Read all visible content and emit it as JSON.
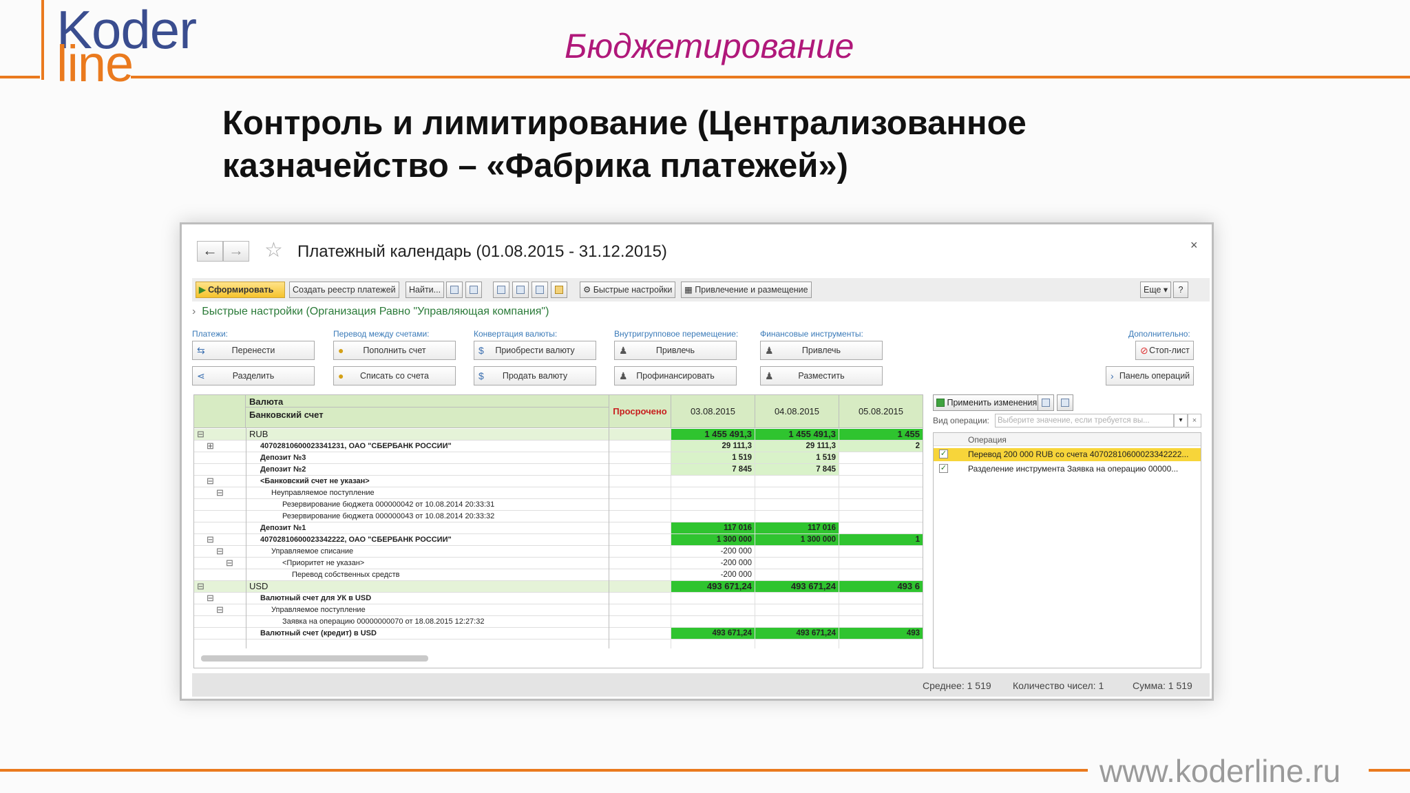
{
  "slide": {
    "logo_top": "Koder",
    "logo_bottom": "line",
    "title": "Бюджетирование",
    "heading_line1": "Контроль и лимитирование (Централизованное",
    "heading_line2": "казначейство – «Фабрика платежей»)",
    "url": "www.koderline.ru"
  },
  "window": {
    "title": "Платежный календарь (01.08.2015 - 31.12.2015)",
    "close": "×",
    "toolbar": {
      "generate": "Сформировать",
      "create_registry": "Создать реестр платежей",
      "find": "Найти...",
      "quick_settings": "Быстрые настройки",
      "attract_place": "Привлечение и размещение",
      "more": "Еще",
      "help": "?"
    },
    "quick_settings_line": "Быстрые настройки (Организация Равно \"Управляющая компания\")",
    "groups": {
      "payments": {
        "label": "Платежи:",
        "btn1": "Перенести",
        "btn2": "Разделить"
      },
      "transfer": {
        "label": "Перевод между счетами:",
        "btn1": "Пополнить счет",
        "btn2": "Списать со счета"
      },
      "conversion": {
        "label": "Конвертация валюты:",
        "btn1": "Приобрести валюту",
        "btn2": "Продать валюту"
      },
      "intragroup": {
        "label": "Внутригрупповое перемещение:",
        "btn1": "Привлечь",
        "btn2": "Профинансировать"
      },
      "financial": {
        "label": "Финансовые инструменты:",
        "btn1": "Привлечь",
        "btn2": "Разместить"
      },
      "additional": {
        "label": "Дополнительно:",
        "btn1": "Стоп-лист",
        "btn2": "Панель операций"
      }
    },
    "grid": {
      "header": {
        "col1a": "Валюта",
        "col1b": "Банковский счет",
        "overdue": "Просрочено",
        "d1": "03.08.2015",
        "d2": "04.08.2015",
        "d3": "05.08.2015"
      },
      "rows": [
        {
          "label": "RUB",
          "v1": "1 455 491,3",
          "v2": "1 455 491,3",
          "v3": "1 455"
        },
        {
          "label": "40702810600023341231, ОАО \"СБЕРБАНК РОССИИ\"",
          "v1": "29 111,3",
          "v2": "29 111,3",
          "v3": "2"
        },
        {
          "label": "Депозит №3",
          "v1": "1 519",
          "v2": "1 519",
          "v3": ""
        },
        {
          "label": "Депозит №2",
          "v1": "7 845",
          "v2": "7 845",
          "v3": ""
        },
        {
          "label": "<Банковский счет не указан>",
          "v1": "",
          "v2": "",
          "v3": ""
        },
        {
          "label": "Неуправляемое поступление",
          "v1": "",
          "v2": "",
          "v3": ""
        },
        {
          "label": "Резервирование бюджета 000000042 от 10.08.2014 20:33:31",
          "v1": "",
          "v2": "",
          "v3": ""
        },
        {
          "label": "Резервирование бюджета 000000043 от 10.08.2014 20:33:32",
          "v1": "",
          "v2": "",
          "v3": ""
        },
        {
          "label": "Депозит №1",
          "v1": "117 016",
          "v2": "117 016",
          "v3": ""
        },
        {
          "label": "40702810600023342222, ОАО \"СБЕРБАНК РОССИИ\"",
          "v1": "1 300 000",
          "v2": "1 300 000",
          "v3": "1"
        },
        {
          "label": "Управляемое списание",
          "v1": "-200 000",
          "v2": "",
          "v3": ""
        },
        {
          "label": "<Приоритет не указан>",
          "v1": "-200 000",
          "v2": "",
          "v3": ""
        },
        {
          "label": "Перевод собственных средств",
          "v1": "-200 000",
          "v2": "",
          "v3": ""
        },
        {
          "label": "USD",
          "v1": "493 671,24",
          "v2": "493 671,24",
          "v3": "493 6"
        },
        {
          "label": "Валютный счет для УК в USD",
          "v1": "",
          "v2": "",
          "v3": ""
        },
        {
          "label": "Управляемое поступление",
          "v1": "",
          "v2": "",
          "v3": ""
        },
        {
          "label": "Заявка на операцию 00000000070 от 18.08.2015 12:27:32",
          "v1": "",
          "v2": "",
          "v3": ""
        },
        {
          "label": "Валютный счет (кредит) в USD",
          "v1": "493 671,24",
          "v2": "493 671,24",
          "v3": "493"
        }
      ]
    },
    "right_panel": {
      "apply": "Применить изменения",
      "op_type_label": "Вид операции:",
      "op_type_placeholder": "Выберите значение, если требуется вы...",
      "col_header": "Операция",
      "items": [
        "Перевод 200 000 RUB со счета 40702810600023342222...",
        "Разделение инструмента Заявка на операцию 00000..."
      ]
    },
    "status": {
      "avg": "Среднее: 1 519",
      "count": "Количество чисел: 1",
      "sum": "Сумма: 1 519"
    }
  },
  "colors": {
    "accent_orange": "#ea7a1e",
    "logo_blue": "#3a4d8f",
    "title_magenta": "#b0187a",
    "green_cell": "#2fc42f",
    "light_green": "#d9f2c9",
    "header_green": "#d7ebc3"
  }
}
